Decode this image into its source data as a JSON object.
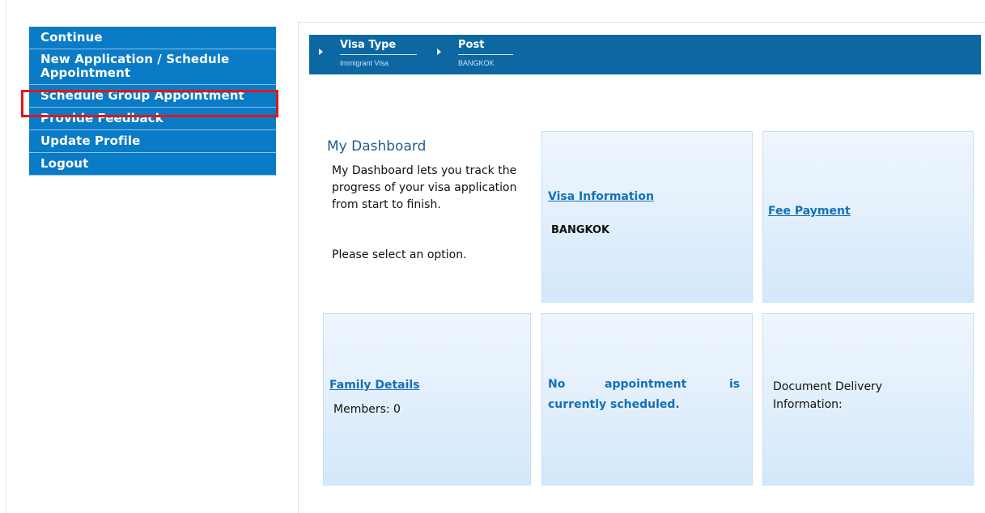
{
  "sidebar": {
    "items": [
      {
        "label": "Continue"
      },
      {
        "label": "New Application / Schedule Appointment"
      },
      {
        "label": "Schedule Group Appointment"
      },
      {
        "label": "Provide Feedback"
      },
      {
        "label": "Update Profile"
      },
      {
        "label": "Logout"
      }
    ],
    "highlight_color": "#e0161b",
    "bg_color": "#0a7bc6"
  },
  "breadcrumb": {
    "items": [
      {
        "title": "Visa Type",
        "sub": "Immigrant Visa"
      },
      {
        "title": "Post",
        "sub": "BANGKOK"
      }
    ],
    "bg_color": "#0d67a3"
  },
  "dashboard": {
    "title": "My Dashboard",
    "description": "My Dashboard lets you track the progress of your visa application from start to finish.",
    "prompt": "Please select an option."
  },
  "tiles": {
    "visa_info": {
      "link": "Visa Information",
      "value": "BANGKOK"
    },
    "fee_payment": {
      "link": "Fee Payment"
    },
    "family_details": {
      "link": "Family Details",
      "value": "Members: 0"
    },
    "appointment": {
      "word1": "No",
      "word2": "appointment",
      "word3": "is",
      "line2": "currently scheduled."
    },
    "document_delivery": {
      "text": "Document Delivery Information:"
    }
  }
}
